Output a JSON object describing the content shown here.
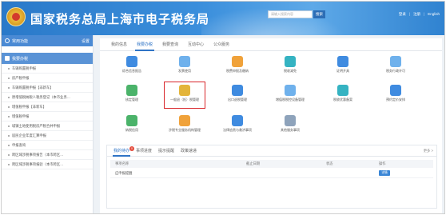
{
  "header": {
    "site_title": "国家税务总局上海市电子税务局",
    "search_placeholder": "请输入搜索内容",
    "search_button": "搜索",
    "links": [
      "登录",
      "注册",
      "English"
    ]
  },
  "sidebar": {
    "head_label": "常用功能",
    "head_action": "设置",
    "section_label": "我要办税",
    "items": [
      "车辆购置税申报",
      "房产税申报",
      "车辆购置税申报【非新车】",
      "原增值税纳税人税务登记（本市业务…",
      "增值税申报【非新车】",
      "增值税申报",
      "城镇土地使用税房产税合并申报",
      "居民企业年度汇算申报",
      "申报查询",
      "跨区域涉税事项报告（本市跨区…",
      "跨区域涉税事项报验（本市跨区…"
    ]
  },
  "main": {
    "tabs": [
      "我的信息",
      "我要办税",
      "我要查询",
      "互动中心",
      "公众服务"
    ],
    "active_tab": "我要办税",
    "functions": [
      {
        "label": "综合信息报告",
        "icon": "report-icon",
        "color": "#3f8be0"
      },
      {
        "label": "发票使用",
        "icon": "invoice-icon",
        "color": "#6fb1ec"
      },
      {
        "label": "税费申报及缴纳",
        "icon": "tax-declare-icon",
        "color": "#f0a23a"
      },
      {
        "label": "税收减免",
        "icon": "reduction-icon",
        "color": "#35b3c2"
      },
      {
        "label": "证明开具",
        "icon": "certificate-icon",
        "color": "#3f8be0"
      },
      {
        "label": "税务行政许可",
        "icon": "license-icon",
        "color": "#6fb1ec"
      },
      {
        "label": "核定管理",
        "icon": "approval-icon",
        "color": "#4bb36a"
      },
      {
        "label": "一般退（抵）税管理",
        "icon": "refund-icon",
        "color": "#e3b43a"
      },
      {
        "label": "出口退税管理",
        "icon": "export-refund-icon",
        "color": "#3f8be0"
      },
      {
        "label": "增值税税控设备管理",
        "icon": "tax-device-icon",
        "color": "#6fb1ec"
      },
      {
        "label": "税收优惠备案",
        "icon": "tax-preference-icon",
        "color": "#35b3c2"
      },
      {
        "label": "预约定价安排",
        "icon": "pricing-icon",
        "color": "#3f8be0"
      },
      {
        "label": "纳税信用",
        "icon": "credit-icon",
        "color": "#4bb36a"
      },
      {
        "label": "涉税专业服务机构管理",
        "icon": "agency-icon",
        "color": "#f0a23a"
      },
      {
        "label": "法律追责与救济事项",
        "icon": "legal-icon",
        "color": "#3f8be0"
      },
      {
        "label": "其他服务事项",
        "icon": "other-service-icon",
        "color": "#8ea3bb"
      }
    ],
    "selected_function": "一般退（抵）税管理"
  },
  "panel": {
    "tabs": [
      "我的待办",
      "事项进度",
      "提示提醒",
      "政策速递"
    ],
    "badge_count": "0",
    "more_label": "更多 >",
    "columns": [
      "事项名称",
      "截止日期",
      "状态",
      "操作"
    ],
    "rows": [
      {
        "name": "应申报提醒",
        "deadline": "",
        "status": "",
        "action": "详情"
      }
    ]
  }
}
